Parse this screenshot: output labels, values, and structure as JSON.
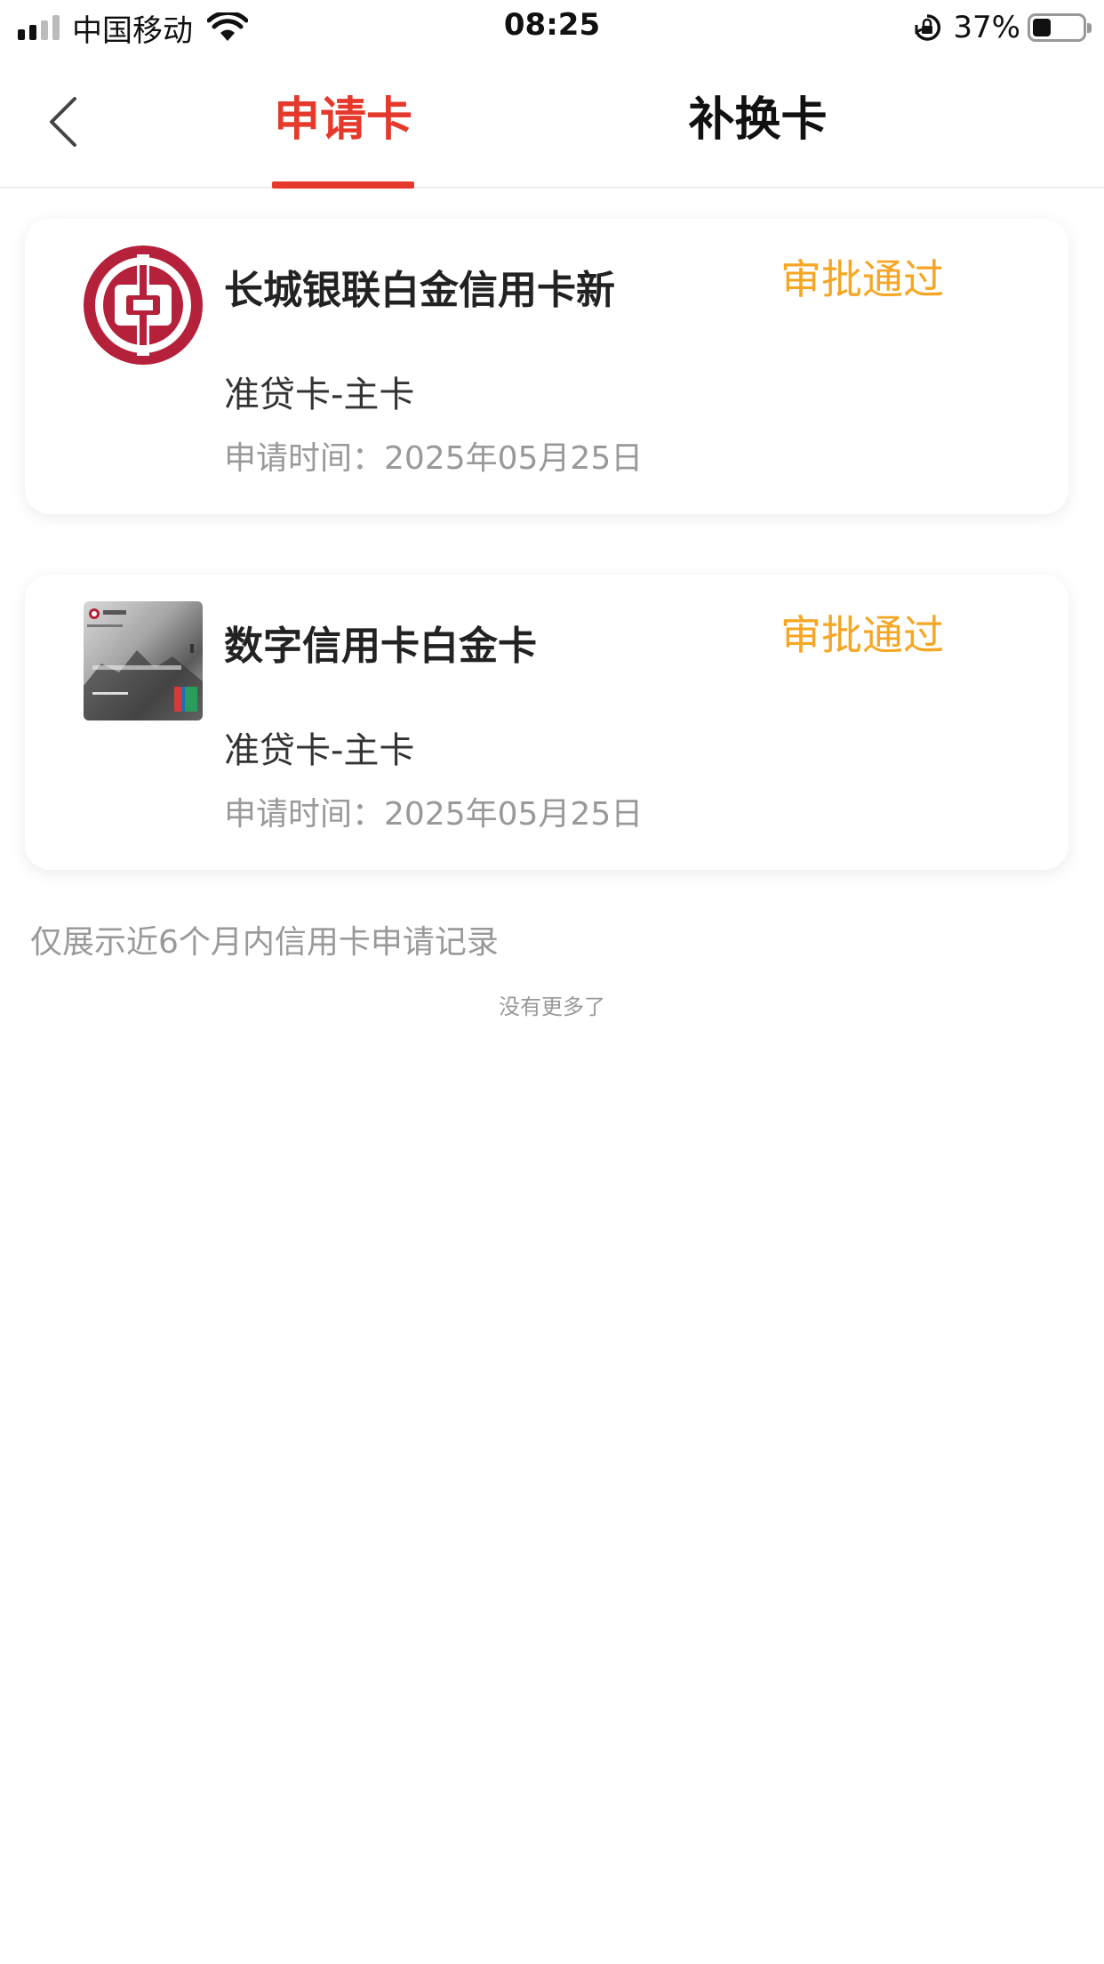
{
  "status_bar": {
    "carrier": "中国移动",
    "time": "08:25",
    "battery_percent": "37%",
    "battery_level": 0.37,
    "signal_bars_active": 2,
    "signal_bars_total": 4
  },
  "header": {
    "tabs": [
      {
        "label": "申请卡",
        "active": true
      },
      {
        "label": "补换卡",
        "active": false
      }
    ],
    "accent_color": "#e5392c"
  },
  "applications": [
    {
      "name": "长城银联白金信用卡新",
      "status": "审批通过",
      "type": "准贷卡-主卡",
      "date": "申请时间：2025年05月25日",
      "image": "bank-of-china-logo-icon"
    },
    {
      "name": "数字信用卡白金卡",
      "status": "审批通过",
      "type": "准贷卡-主卡",
      "date": "申请时间：2025年05月25日",
      "image": "credit-card-image-icon"
    }
  ],
  "note": "仅展示近6个月内信用卡申请记录",
  "footer": "没有更多了",
  "colors": {
    "status_color": "#f5a623",
    "logo_red": "#b5213a"
  }
}
